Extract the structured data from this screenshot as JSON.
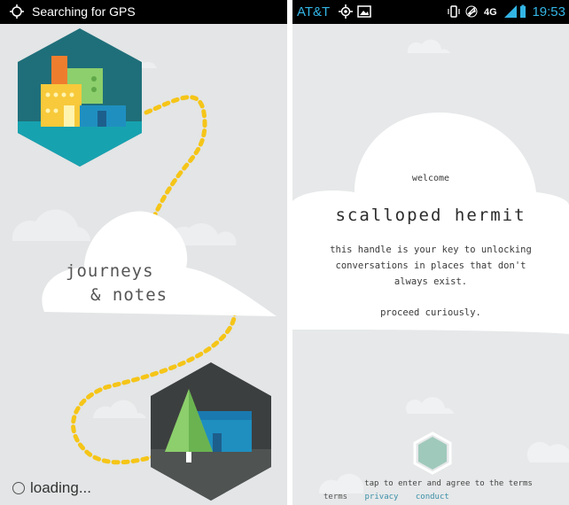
{
  "left_screen": {
    "status_text": "Searching for GPS",
    "title_line1": "journeys",
    "title_line2": "& notes",
    "loading_text": "loading..."
  },
  "right_screen": {
    "status": {
      "carrier": "AT&T",
      "time": "19:53"
    },
    "welcome": "welcome",
    "handle": "scalloped hermit",
    "description_lines": [
      "this handle is your key to unlocking",
      "conversations in places that don't",
      "always exist."
    ],
    "proceed": "proceed curiously.",
    "tap_text": "tap to enter and agree to the terms",
    "links": {
      "terms": "terms",
      "privacy": "privacy",
      "conduct": "conduct"
    }
  },
  "colors": {
    "city_hex": "#1f6f7a",
    "forest_hex": "#3c3f3f",
    "dots": "#f5c518",
    "accent_blue": "#33b5e5",
    "teal_hex": "#9fc9bb"
  }
}
